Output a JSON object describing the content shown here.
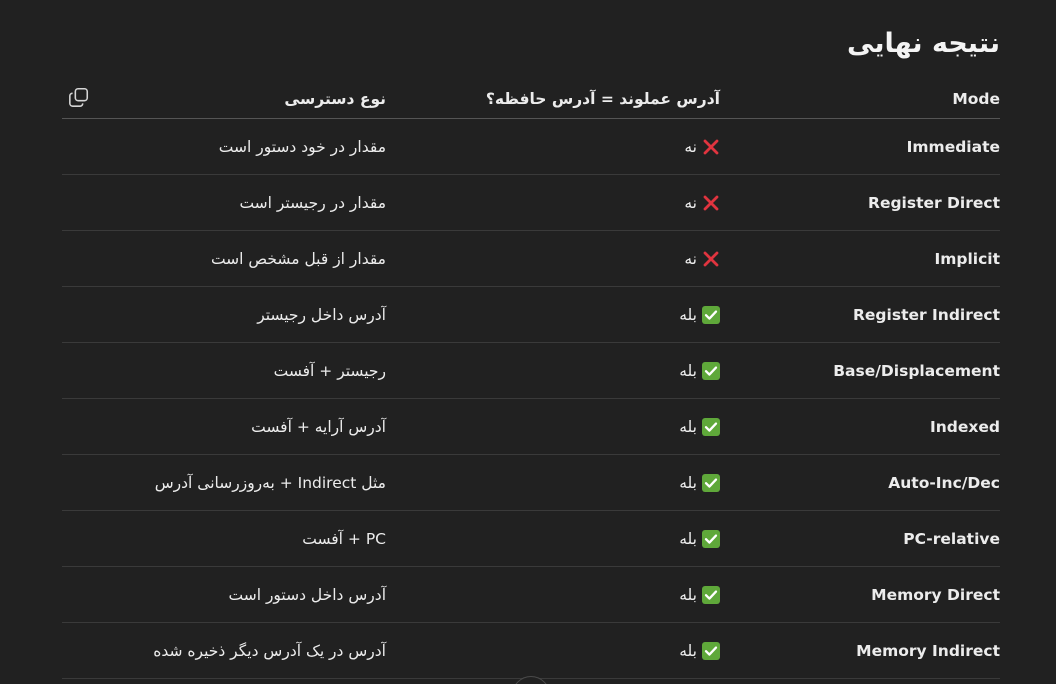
{
  "title": "نتیجه نهایی",
  "table": {
    "headers": {
      "mode": "Mode",
      "equality": "آدرس عملوند = آدرس حافظه؟",
      "access": "نوع دسترسی"
    },
    "rows": [
      {
        "mode": "Immediate",
        "status": "no",
        "status_text": "نه",
        "access": "مقدار در خود دستور است"
      },
      {
        "mode": "Register Direct",
        "status": "no",
        "status_text": "نه",
        "access": "مقدار در رجیستر است"
      },
      {
        "mode": "Implicit",
        "status": "no",
        "status_text": "نه",
        "access": "مقدار از قبل مشخص است"
      },
      {
        "mode": "Register Indirect",
        "status": "yes",
        "status_text": "بله",
        "access": "آدرس داخل رجیستر"
      },
      {
        "mode": "Base/Displacement",
        "status": "yes",
        "status_text": "بله",
        "access": "رجیستر + آفست"
      },
      {
        "mode": "Indexed",
        "status": "yes",
        "status_text": "بله",
        "access": "آدرس آرایه + آفست"
      },
      {
        "mode": "Auto-Inc/Dec",
        "status": "yes",
        "status_text": "بله",
        "access": "مثل Indirect + به‌روزرسانی آدرس"
      },
      {
        "mode": "PC-relative",
        "status": "yes",
        "status_text": "بله",
        "access": "PC + آفست"
      },
      {
        "mode": "Memory Direct",
        "status": "yes",
        "status_text": "بله",
        "access": "آدرس داخل دستور است"
      },
      {
        "mode": "Memory Indirect",
        "status": "yes",
        "status_text": "بله",
        "access": "آدرس در یک آدرس دیگر ذخیره شده"
      }
    ]
  },
  "icons": {
    "copy": "copy-icon",
    "yes": "check-mark-icon",
    "no": "cross-mark-icon"
  },
  "colors": {
    "background": "#212121",
    "text": "#ececec",
    "check_bg": "#5fa83a",
    "cross": "#e0343f"
  }
}
